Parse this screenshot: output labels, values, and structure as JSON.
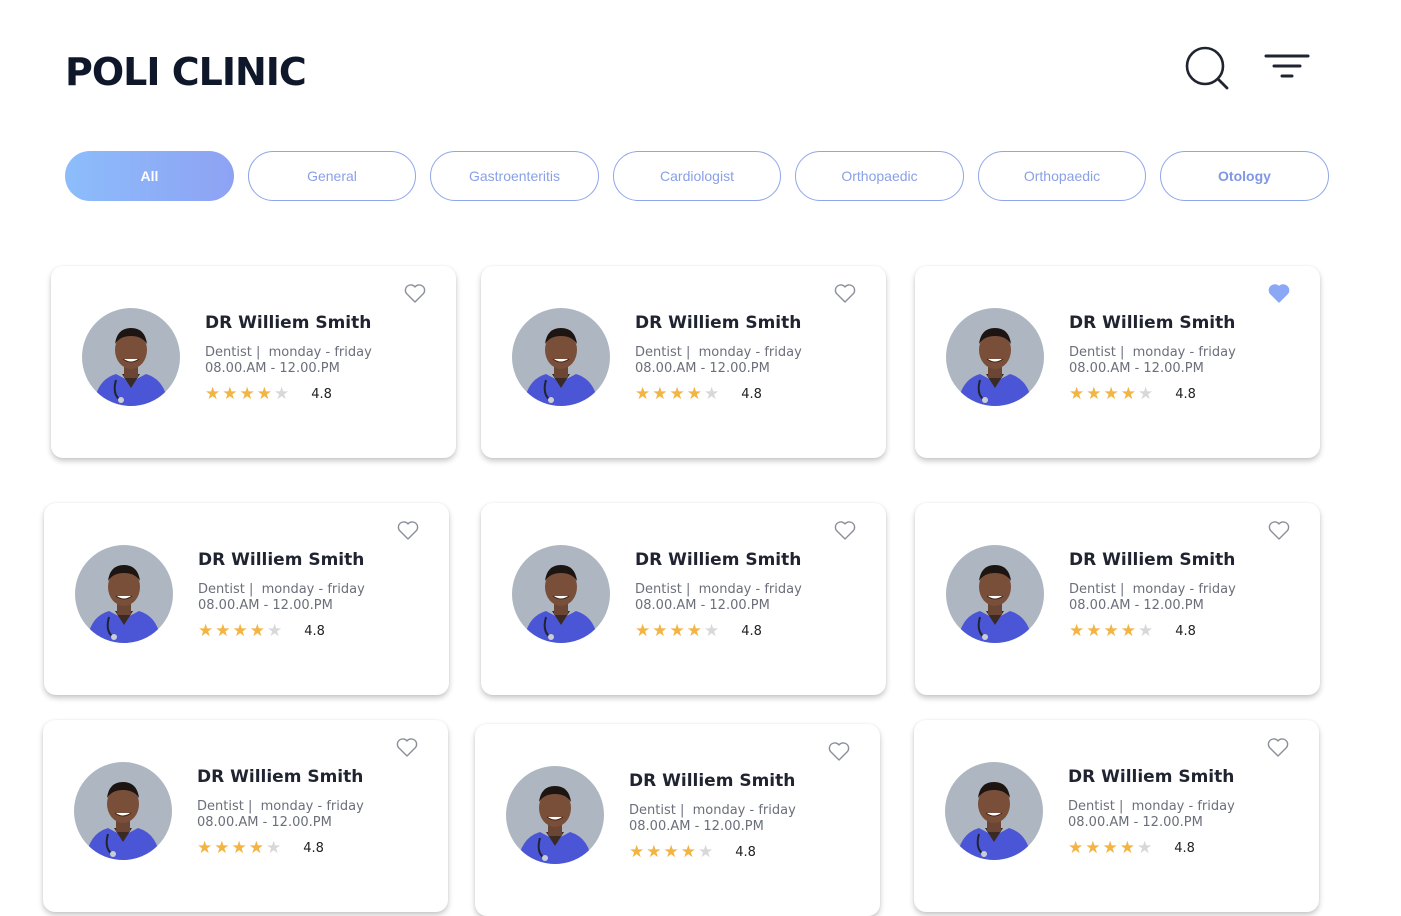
{
  "header": {
    "title": "POLI CLINIC"
  },
  "icons": {
    "search": "search-icon",
    "filter": "filter-icon",
    "favorite": "heart-icon"
  },
  "colors": {
    "accent": "#8ea2f3",
    "star": "#f3b443",
    "favorite_active": "#8aa8f5"
  },
  "categories": [
    {
      "label": "All",
      "active": true
    },
    {
      "label": "General"
    },
    {
      "label": "Gastroenteritis"
    },
    {
      "label": "Cardiologist"
    },
    {
      "label": "Orthopaedic"
    },
    {
      "label": "Orthopaedic"
    },
    {
      "label": "Otology",
      "bold": true
    }
  ],
  "doctors": [
    {
      "name": "DR Williem Smith",
      "specialty": "Dentist |",
      "days": "monday - friday",
      "hours": "08.00.AM - 12.00.PM",
      "stars": 4,
      "rating": "4.8",
      "favorite": false
    },
    {
      "name": "DR Williem Smith",
      "specialty": "Dentist |",
      "days": "monday - friday",
      "hours": "08.00.AM - 12.00.PM",
      "stars": 4,
      "rating": "4.8",
      "favorite": false
    },
    {
      "name": "DR Williem Smith",
      "specialty": "Dentist |",
      "days": "monday - friday",
      "hours": "08.00.AM - 12.00.PM",
      "stars": 4,
      "rating": "4.8",
      "favorite": true
    },
    {
      "name": "DR Williem Smith",
      "specialty": "Dentist |",
      "days": "monday - friday",
      "hours": "08.00.AM - 12.00.PM",
      "stars": 4,
      "rating": "4.8",
      "favorite": false
    },
    {
      "name": "DR Williem Smith",
      "specialty": "Dentist |",
      "days": "monday - friday",
      "hours": "08.00.AM - 12.00.PM",
      "stars": 4,
      "rating": "4.8",
      "favorite": false
    },
    {
      "name": "DR Williem Smith",
      "specialty": "Dentist |",
      "days": "monday - friday",
      "hours": "08.00.AM - 12.00.PM",
      "stars": 4,
      "rating": "4.8",
      "favorite": false
    },
    {
      "name": "DR Williem Smith",
      "specialty": "Dentist |",
      "days": "monday - friday",
      "hours": "08.00.AM - 12.00.PM",
      "stars": 4,
      "rating": "4.8",
      "favorite": false
    },
    {
      "name": "DR Williem Smith",
      "specialty": "Dentist |",
      "days": "monday - friday",
      "hours": "08.00.AM - 12.00.PM",
      "stars": 4,
      "rating": "4.8",
      "favorite": false
    },
    {
      "name": "DR Williem Smith",
      "specialty": "Dentist |",
      "days": "monday - friday",
      "hours": "08.00.AM - 12.00.PM",
      "stars": 4,
      "rating": "4.8",
      "favorite": false
    }
  ]
}
